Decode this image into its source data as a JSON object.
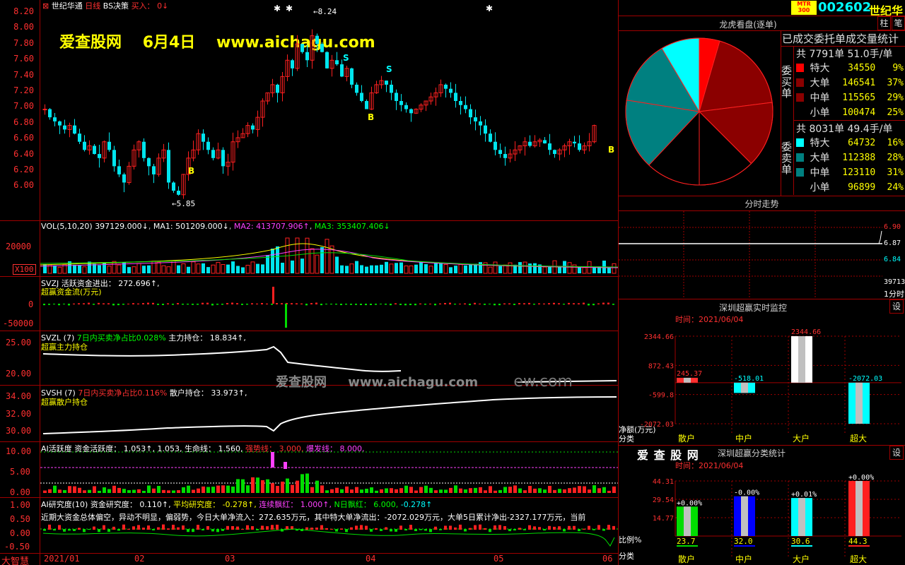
{
  "top_header": {
    "stock_name": "世纪华通",
    "period": "日线",
    "indicator": "BS决策",
    "buy_label": "买入：",
    "buy_value": "0↓",
    "watermark_site": "爱查股网",
    "watermark_date": "6月4日",
    "watermark_url": "www.aichagu.com"
  },
  "price_axis": [
    "8.20",
    "8.00",
    "7.80",
    "7.60",
    "7.40",
    "7.20",
    "7.00",
    "6.80",
    "6.60",
    "6.40",
    "6.20",
    "6.00"
  ],
  "price_annotations": {
    "high": "8.24",
    "low": "5.85",
    "b_mark": "B",
    "s_mark": "S"
  },
  "volume": {
    "header_label": "VOL(5,10,20)",
    "header_value": "397129.000↓",
    "ma1_label": "MA1:",
    "ma1_value": "501209.000↓",
    "ma2_label": "MA2:",
    "ma2_value": "413707.906↑",
    "ma3_label": "MA3:",
    "ma3_value": "353407.406↓",
    "axis_label": "20000",
    "unit_badge": "X100"
  },
  "svzj": {
    "name": "SVZJ",
    "desc": "活跃资金进出：",
    "value": "272.696↑,",
    "subtitle": "超赢资金流(万元)",
    "axis": [
      "0",
      "-50000"
    ]
  },
  "svzl": {
    "name": "SVZL",
    "param": "(7)",
    "desc": "7日内买卖净占比0.028%",
    "main_label": "主力持仓：",
    "main_value": "18.834↑,",
    "subtitle": "超赢主力持仓",
    "axis": [
      "25.00",
      "20.00"
    ]
  },
  "svsh": {
    "name": "SVSH",
    "param": "(7)",
    "desc": "7日内买卖净占比0.116%",
    "retail_label": "散户持仓：",
    "retail_value": "33.973↑,",
    "subtitle": "超赢散户持仓",
    "axis": [
      "34.00",
      "32.00",
      "30.00"
    ]
  },
  "center_watermark": {
    "site": "爱查股网",
    "url": "www.aichagu.com",
    "tail": "ew.com"
  },
  "ai_activity": {
    "name": "AI活跃度",
    "fund_label": "资金活跃度：",
    "fund_value": "1.053↑,",
    "second_value": "1.053,",
    "life_label": "生命线：",
    "life_value": "1.560,",
    "strong_label": "强势线：",
    "strong_value": "3.000,",
    "burst_label": "爆发线：",
    "burst_value": "8.000,",
    "axis": [
      "10.00",
      "5.00",
      "0.00"
    ]
  },
  "ai_research": {
    "name": "AI研究度(10)",
    "fund_label": "资金研究度：",
    "fund_value": "0.110↑,",
    "avg_label": "平均研究度：",
    "avg_value": "-0.278↑,",
    "cont_label": "连续飘红：",
    "cont_value": "1.000↑,",
    "n_label": "N日飘红：",
    "n_value": "6.000,",
    "last_value": "-0.278↑",
    "comment": "近期大资金总体偏空，异动不明显，偏弱势，今日大单净流入：272.635万元，其中特大单净流出：-2072.029万元，大单5日累计净出-2327.177万元，当前",
    "axis": [
      "1.00",
      "0.50",
      "0.00",
      "-0.50"
    ]
  },
  "bottom_axis": {
    "brand": "大智慧",
    "labels": [
      "2021/01",
      "02",
      "03",
      "04",
      "05",
      "06"
    ]
  },
  "right_header": {
    "badge_top": "MTR",
    "badge_bottom": "300",
    "code": "002602",
    "name": "世纪华",
    "btn_zhu": "柱",
    "btn_bi": "笔"
  },
  "dragon_panel": {
    "title": "龙虎看盘(逐单)",
    "stats_title": "已成交委托单成交量统计",
    "buy_side_label": "委买单",
    "sell_side_label": "委卖单",
    "buy_total": "共 7791单 51.0手/单",
    "sell_total": "共 8031单 49.4手/单",
    "buy_rows": [
      {
        "label": "特大",
        "value": "34550",
        "pct": "9%",
        "color": "#ff0000"
      },
      {
        "label": "大单",
        "value": "146541",
        "pct": "37%",
        "color": "#8b0000"
      },
      {
        "label": "中单",
        "value": "115565",
        "pct": "29%",
        "color": "#8b0000"
      },
      {
        "label": "小单",
        "value": "100474",
        "pct": "25%",
        "color": "#000000"
      }
    ],
    "sell_rows": [
      {
        "label": "特大",
        "value": "64732",
        "pct": "16%",
        "color": "#00ffff"
      },
      {
        "label": "大单",
        "value": "112388",
        "pct": "28%",
        "color": "#008080"
      },
      {
        "label": "中单",
        "value": "123110",
        "pct": "31%",
        "color": "#008080"
      },
      {
        "label": "小单",
        "value": "96899",
        "pct": "24%",
        "color": "#000000"
      }
    ]
  },
  "intraday": {
    "title": "分时走势",
    "axis": [
      "6.90",
      "6.87",
      "6.84"
    ],
    "volume_label": "39713",
    "unit": "1分时"
  },
  "realtime_monitor": {
    "title": "深圳超赢实时监控",
    "btn": "设",
    "time_label": "时间：2021/06/04",
    "y_axis": [
      "2344.66",
      "872.43",
      "-599.8",
      "-2072.03"
    ],
    "y_title": "净额(万元)",
    "x_title": "分类",
    "categories": [
      "散户",
      "中户",
      "大户",
      "超大"
    ],
    "values": [
      245.37,
      -518.01,
      2344.66,
      -2072.03
    ],
    "value_labels": [
      "245.37",
      "-518.01",
      "2344.66",
      "-2072.03"
    ],
    "colors": [
      "#ff3030",
      "#00ffff",
      "#ffffff",
      "#00ffff"
    ]
  },
  "category_stats": {
    "brand": "爱 查 股 网",
    "title": "深圳超赢分类统计",
    "btn": "设",
    "time_label": "时间：2021/06/04",
    "y_axis": [
      "44.31",
      "29.54",
      "14.77"
    ],
    "y_title": "比例%",
    "x_title": "分类",
    "categories": [
      "散户",
      "中户",
      "大户",
      "超大"
    ],
    "values": [
      23.7,
      32.0,
      30.6,
      44.3
    ],
    "value_labels": [
      "23.7",
      "32.0",
      "30.6",
      "44.3"
    ],
    "change_labels": [
      "+0.00%",
      "-0.00%",
      "+0.01%",
      "+0.00%"
    ],
    "colors": [
      "#00dd00",
      "#0000ff",
      "#00ffff",
      "#ff2020"
    ]
  },
  "chart_data": {
    "type": "bar",
    "title": "深圳超赢实时监控",
    "categories": [
      "散户",
      "中户",
      "大户",
      "超大"
    ],
    "series": [
      {
        "name": "净额(万元)",
        "values": [
          245.37,
          -518.01,
          2344.66,
          -2072.03
        ]
      },
      {
        "name": "比例%",
        "values": [
          23.7,
          32.0,
          30.6,
          44.3
        ]
      }
    ],
    "ylabel": "净额(万元)",
    "ylim": [
      -2072.03,
      2344.66
    ]
  }
}
